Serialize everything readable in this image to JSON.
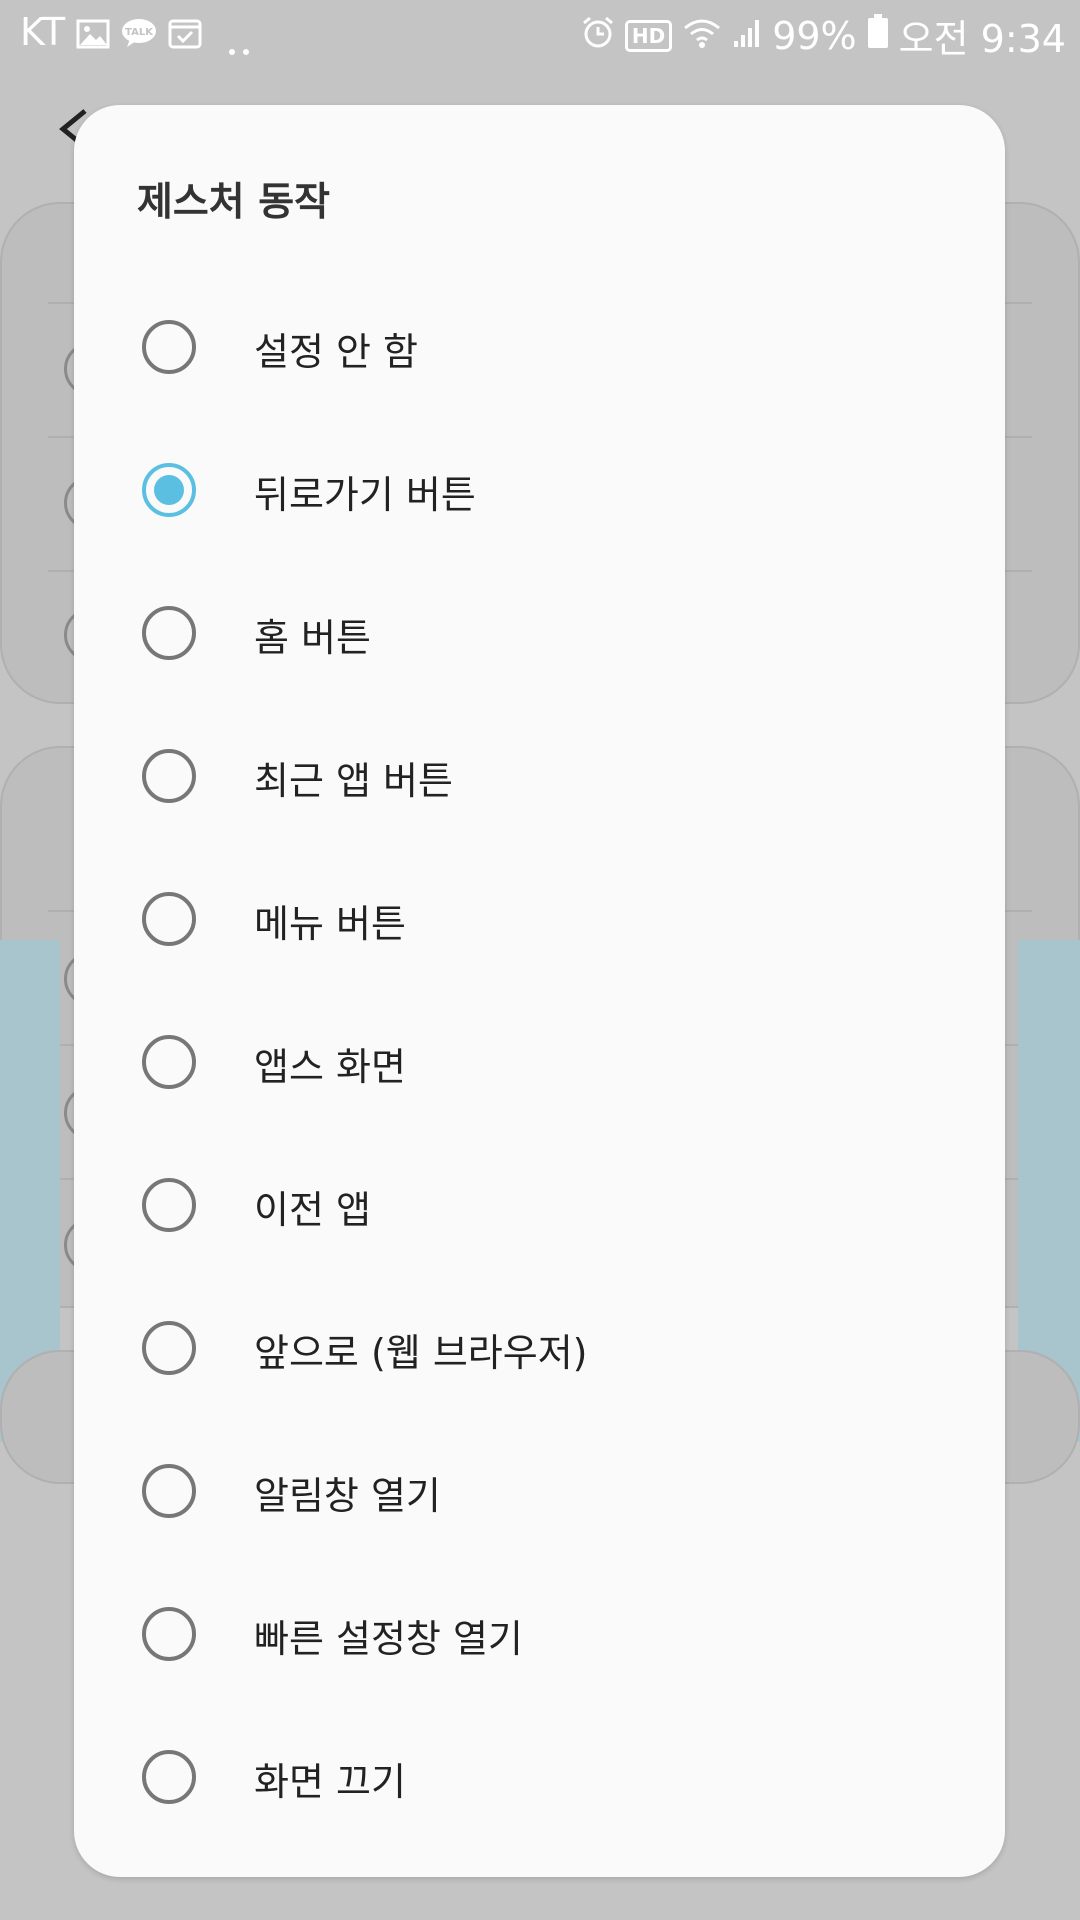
{
  "status_bar": {
    "carrier": "KT",
    "battery": "99%",
    "time": "오전 9:34",
    "hd": "HD",
    "icons": [
      "image-icon",
      "kakaotalk-icon",
      "calendar-check-icon",
      "more-dots-icon",
      "alarm-icon",
      "hd-icon",
      "wifi-icon",
      "signal-icon",
      "battery-icon"
    ]
  },
  "dialog": {
    "title": "제스처 동작",
    "selected_index": 1,
    "options": [
      {
        "label": "설정 안 함"
      },
      {
        "label": "뒤로가기 버튼"
      },
      {
        "label": "홈 버튼"
      },
      {
        "label": "최근 앱 버튼"
      },
      {
        "label": "메뉴 버튼"
      },
      {
        "label": "앱스 화면"
      },
      {
        "label": "이전 앱"
      },
      {
        "label": "앞으로 (웹 브라우저)"
      },
      {
        "label": "알림창 열기"
      },
      {
        "label": "빠른 설정창 열기"
      },
      {
        "label": "화면 끄기"
      }
    ]
  },
  "colors": {
    "accent": "#5bbfe2",
    "dialog_bg": "#fafafa",
    "scrim_bg": "#c4c4c4"
  }
}
